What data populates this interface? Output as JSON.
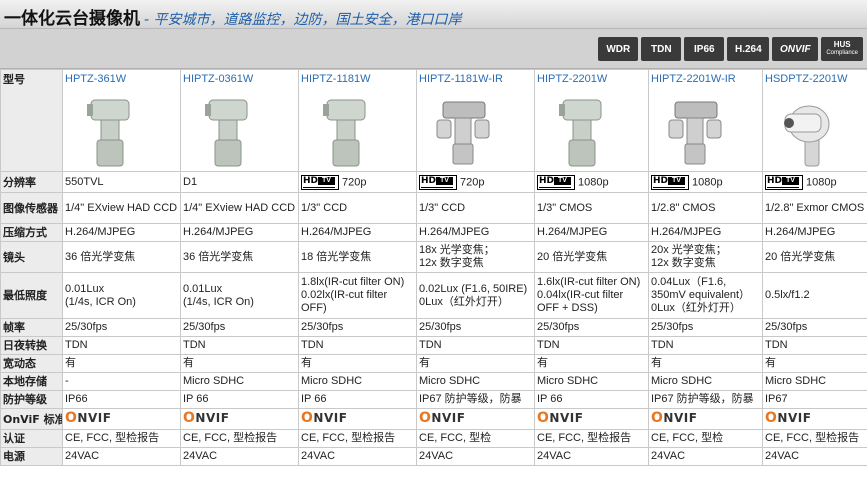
{
  "header": {
    "title": "一体化云台摄像机",
    "subtitle": "- 平安城市，道路监控，边防，国土安全，港口口岸"
  },
  "badges": [
    "WDR",
    "TDN",
    "IP66",
    "H.264",
    "ONVIF"
  ],
  "hus_badge": {
    "line1": "HUS",
    "line2": "Compliance"
  },
  "onvif_text": "NVIF",
  "hdtv": {
    "hd": "HD",
    "tv": "TV"
  },
  "labels": {
    "model": "型号",
    "resolution": "分辨率",
    "sensor": "图像传感器",
    "compression": "压缩方式",
    "lens": "镜头",
    "min_illum": "最低照度",
    "fps": "帧率",
    "day_night": "日夜转换",
    "wdr": "宽动态",
    "storage": "本地存储",
    "protection": "防护等级",
    "onvif": "OnViF 标准",
    "cert": "认证",
    "power": "电源"
  },
  "products": [
    {
      "model": "HPTZ-361W",
      "camera": "ptz-camera",
      "hdtv": false,
      "resolution": "550TVL",
      "sensor": "1/4\" EXview HAD CCD",
      "compression": "H.264/MJPEG",
      "lens": "36 倍光学变焦",
      "illum": "0.01Lux\n(1/4s, ICR On)",
      "fps": "25/30fps",
      "day_night": "TDN",
      "wdr": "有",
      "storage": "-",
      "protection": "IP66",
      "cert": "CE, FCC, 型检报告",
      "power": "24VAC"
    },
    {
      "model": "HIPTZ-0361W",
      "camera": "ptz-camera",
      "hdtv": false,
      "resolution": "D1",
      "sensor": "1/4\" EXview HAD CCD",
      "compression": "H.264/MJPEG",
      "lens": "36 倍光学变焦",
      "illum": "0.01Lux\n(1/4s, ICR On)",
      "fps": "25/30fps",
      "day_night": "TDN",
      "wdr": "有",
      "storage": "Micro SDHC",
      "protection": "IP 66",
      "cert": "CE, FCC, 型检报告",
      "power": "24VAC"
    },
    {
      "model": "HIPTZ-1181W",
      "camera": "ptz-camera",
      "hdtv": true,
      "resolution": "720p",
      "sensor": "1/3\" CCD",
      "compression": "H.264/MJPEG",
      "lens": "18 倍光学变焦",
      "illum": "1.8lx(IR-cut filter ON)\n0.02lx(IR-cut filter\nOFF)",
      "fps": "25/30fps",
      "day_night": "TDN",
      "wdr": "有",
      "storage": "Micro SDHC",
      "protection": "IP 66",
      "cert": "CE, FCC, 型检报告",
      "power": "24VAC"
    },
    {
      "model": "HIPTZ-1181W-IR",
      "camera": "ir-ptz-camera",
      "hdtv": true,
      "resolution": "720p",
      "sensor": "1/3\" CCD",
      "compression": "H.264/MJPEG",
      "lens": "18x 光学变焦；\n12x 数字变焦",
      "illum": "0.02Lux (F1.6, 50IRE)\n0Lux（红外灯开）",
      "fps": "25/30fps",
      "day_night": "TDN",
      "wdr": "有",
      "storage": "Micro SDHC",
      "protection": "IP67 防护等级，防暴",
      "cert": "CE, FCC, 型检",
      "power": "24VAC"
    },
    {
      "model": "HIPTZ-2201W",
      "camera": "ptz-camera",
      "hdtv": true,
      "resolution": "1080p",
      "sensor": "1/3\" CMOS",
      "compression": "H.264/MJPEG",
      "lens": "20 倍光学变焦",
      "illum": "1.6lx(IR-cut filter ON)\n0.04lx(IR-cut filter\nOFF + DSS)",
      "fps": "25/30fps",
      "day_night": "TDN",
      "wdr": "有",
      "storage": "Micro SDHC",
      "protection": "IP 66",
      "cert": "CE, FCC, 型检报告",
      "power": "24VAC"
    },
    {
      "model": "HIPTZ-2201W-IR",
      "camera": "ir-ptz-camera",
      "hdtv": true,
      "resolution": "1080p",
      "sensor": "1/2.8\" CMOS",
      "compression": "H.264/MJPEG",
      "lens": "20x 光学变焦；\n12x 数字变焦",
      "illum": "0.04Lux（F1.6,\n350mV equivalent）\n0Lux（红外灯开）",
      "fps": "25/30fps",
      "day_night": "TDN",
      "wdr": "有",
      "storage": "Micro SDHC",
      "protection": "IP67 防护等级，防暴",
      "cert": "CE, FCC, 型检",
      "power": "24VAC"
    },
    {
      "model": "HSDPTZ-2201W",
      "camera": "dome-ptz-camera",
      "hdtv": true,
      "resolution": "1080p",
      "sensor": "1/2.8\" Exmor CMOS",
      "compression": "H.264/MJPEG",
      "lens": "20 倍光学变焦",
      "illum": "0.5lx/f1.2",
      "fps": "25/30fps",
      "day_night": "TDN",
      "wdr": "有",
      "storage": "Micro SDHC",
      "protection": "IP67",
      "cert": "CE, FCC, 型检报告",
      "power": "24VAC"
    }
  ]
}
